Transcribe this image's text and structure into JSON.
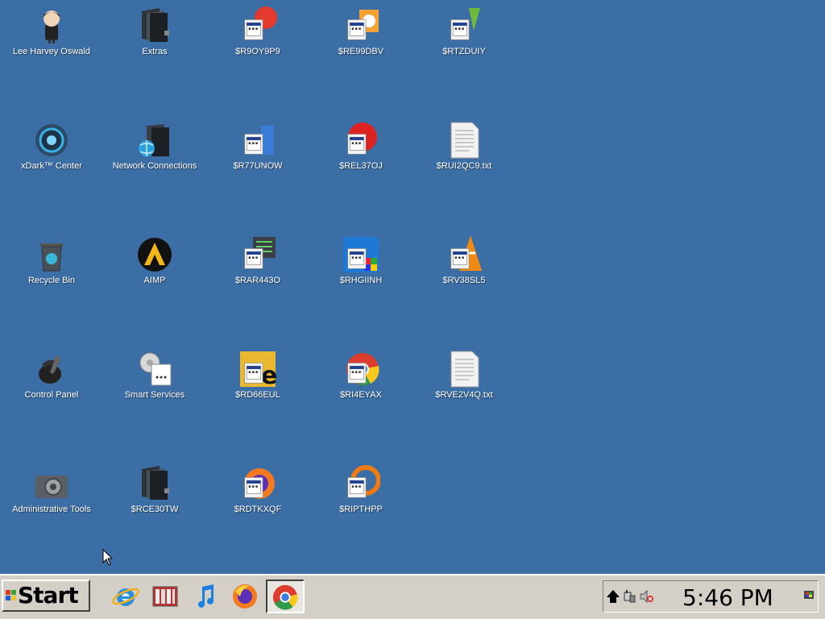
{
  "desktop": {
    "background": "#3c6ea6",
    "icons": [
      {
        "label": "Lee Harvey Oswald",
        "icon": "character-avatar-icon"
      },
      {
        "label": "Extras",
        "icon": "folder-icon"
      },
      {
        "label": "$R9OY9P9",
        "icon": "app-shortcut-icon"
      },
      {
        "label": "$RE99DBV",
        "icon": "app-shortcut-icon"
      },
      {
        "label": "$RTZDUIY",
        "icon": "app-shortcut-icon"
      },
      {
        "label": "xDark™ Center",
        "icon": "xdark-center-icon"
      },
      {
        "label": "Network Connections",
        "icon": "network-folder-icon"
      },
      {
        "label": "$R77UNOW",
        "icon": "app-shortcut-icon"
      },
      {
        "label": "$REL37OJ",
        "icon": "app-shortcut-icon"
      },
      {
        "label": "$RUI2QC9.txt",
        "icon": "text-file-icon"
      },
      {
        "label": "Recycle Bin",
        "icon": "recycle-bin-icon"
      },
      {
        "label": "AIMP",
        "icon": "aimp-icon"
      },
      {
        "label": "$RAR443O",
        "icon": "app-shortcut-icon"
      },
      {
        "label": "$RHGIINH",
        "icon": "app-shortcut-icon"
      },
      {
        "label": "$RV38SL5",
        "icon": "app-shortcut-icon"
      },
      {
        "label": "Control Panel",
        "icon": "control-panel-icon"
      },
      {
        "label": "Smart Services",
        "icon": "smart-services-icon"
      },
      {
        "label": "$RD66EUL",
        "icon": "app-shortcut-icon"
      },
      {
        "label": "$RI4EYAX",
        "icon": "app-shortcut-icon"
      },
      {
        "label": "$RVE2V4Q.txt",
        "icon": "text-file-icon"
      },
      {
        "label": "Administrative Tools",
        "icon": "admin-tools-icon"
      },
      {
        "label": "$RCE30TW",
        "icon": "folder-icon"
      },
      {
        "label": "$RDTKXQF",
        "icon": "app-shortcut-icon"
      },
      {
        "label": "$RIPTHPP",
        "icon": "app-shortcut-icon"
      }
    ]
  },
  "taskbar": {
    "start_label": "Start",
    "quick_launch": [
      {
        "name": "internet-explorer-icon"
      },
      {
        "name": "media-library-icon"
      },
      {
        "name": "music-note-icon"
      },
      {
        "name": "firefox-icon"
      }
    ],
    "active_task": {
      "name": "chrome-icon"
    },
    "tray": {
      "icons": [
        "flag-up-icon",
        "network-plug-icon",
        "muted-speaker-icon"
      ],
      "clock": "5:46 PM"
    }
  }
}
